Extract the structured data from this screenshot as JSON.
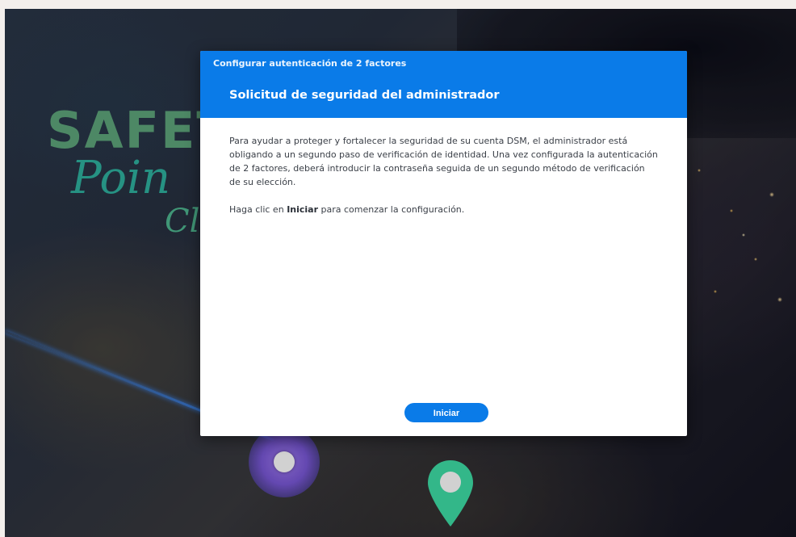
{
  "background": {
    "logo": {
      "line1": "SAFET",
      "line2": "Poin",
      "line3": "Cl"
    }
  },
  "dialog": {
    "window_title": "Configurar autenticación de 2 factores",
    "step_title": "Solicitud de seguridad del administrador",
    "paragraph1": "Para ayudar a proteger y fortalecer la seguridad de su cuenta DSM, el administrador está obligando a un segundo paso de verificación de identidad. Una vez configurada la autenticación de 2 factores, deberá introducir la contraseña seguida de un segundo método de verificación de su elección.",
    "paragraph2_prefix": "Haga clic en ",
    "paragraph2_bold": "Iniciar",
    "paragraph2_suffix": " para comenzar la configuración.",
    "start_button_label": "Iniciar"
  },
  "colors": {
    "accent": "#0a7be8",
    "header_text": "#ffffff",
    "body_text": "#3a3f47"
  }
}
